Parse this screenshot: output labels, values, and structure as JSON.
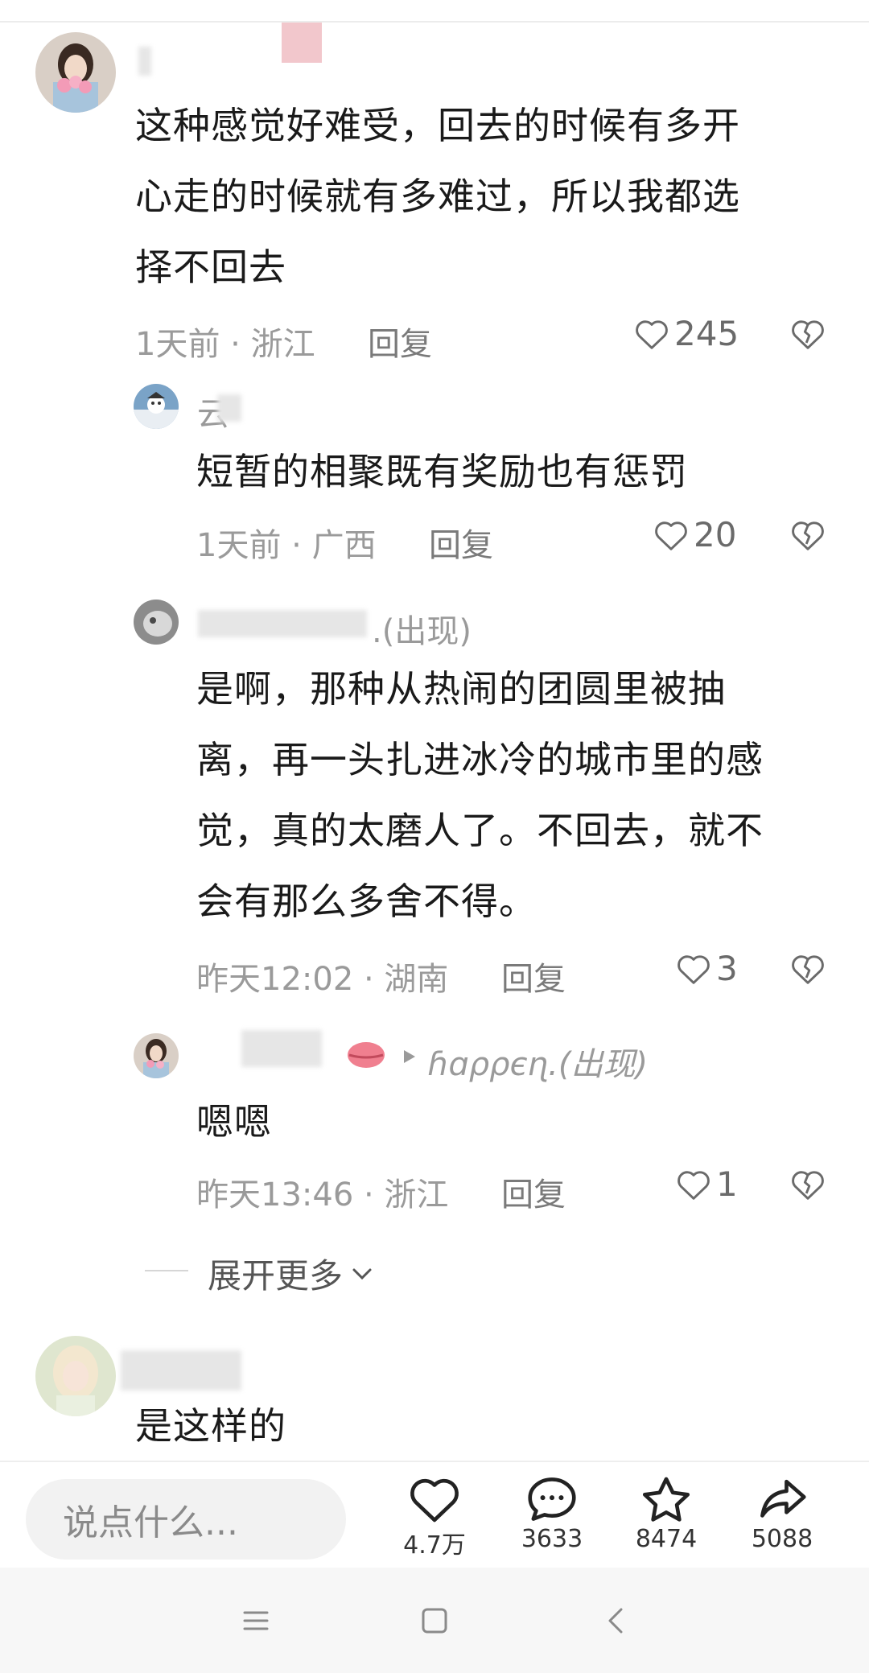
{
  "comments": [
    {
      "text_lines": [
        "这种感觉好难受，回去的时候有多开",
        "心走的时候就有多难过，所以我都选",
        "择不回去"
      ],
      "meta": "1天前 · 浙江",
      "reply": "回复",
      "likes": "245"
    }
  ],
  "replies": [
    {
      "name": "云",
      "text_lines": [
        "短暂的相聚既有奖励也有惩罚"
      ],
      "meta": "1天前 · 广西",
      "reply": "回复",
      "likes": "20"
    },
    {
      "name": ".(出现)",
      "text_lines": [
        "是啊，那种从热闹的团圆里被抽",
        "离，再一头扎进冰冷的城市里的感",
        "觉，真的太磨人了。不回去，就不",
        "会有那么多舍不得。"
      ],
      "meta": "昨天12:02 · 湖南",
      "reply": "回复",
      "likes": "3"
    },
    {
      "name": "ɦɑρρєɳ.(出现)",
      "text_lines": [
        "嗯嗯"
      ],
      "meta": "昨天13:46 · 浙江",
      "reply": "回复",
      "likes": "1"
    }
  ],
  "expand_more": "展开更多",
  "next_comment": {
    "text": "是这样的"
  },
  "bottom_bar": {
    "input_placeholder": "说点什么...",
    "like_count": "4.7万",
    "comment_count": "3633",
    "star_count": "8474",
    "share_count": "5088"
  },
  "icons": [
    "heart-icon",
    "broken-heart-icon",
    "chevron-down-icon",
    "comment-bubble-icon",
    "star-icon",
    "share-icon",
    "menu-icon",
    "home-square-icon",
    "back-chevron-icon"
  ]
}
